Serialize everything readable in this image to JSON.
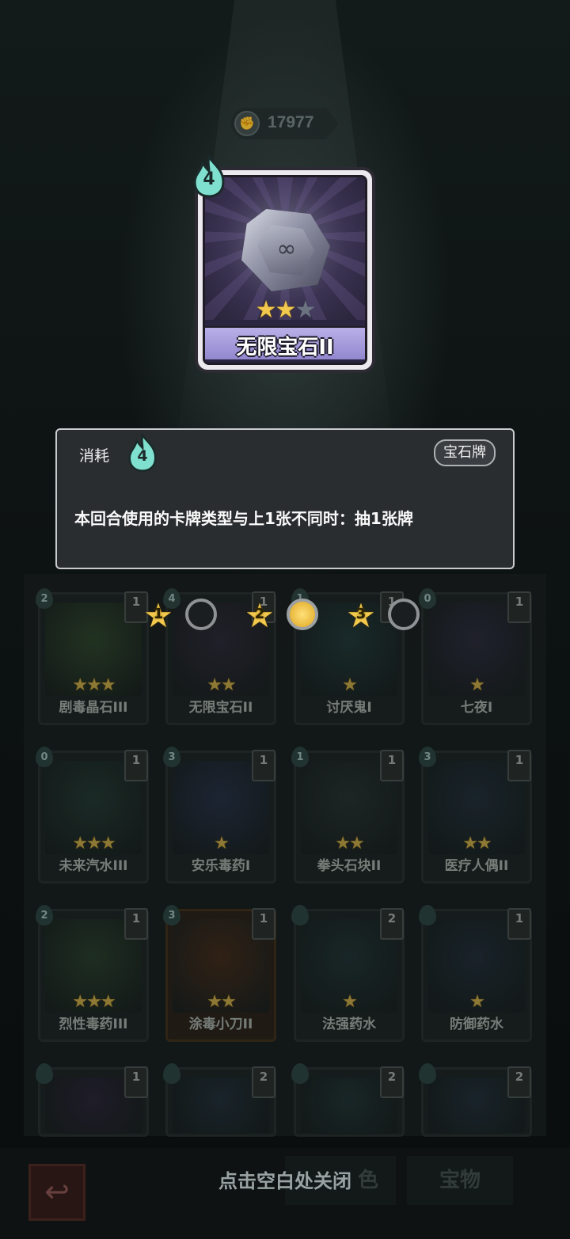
{
  "header": {
    "currency_value": "17977",
    "currency_icon": "fist-coin-icon"
  },
  "featured_card": {
    "cost": "4",
    "name": "无限宝石II",
    "stars_filled": 2,
    "stars_total": 3
  },
  "description": {
    "cost_label": "消耗",
    "cost": "4",
    "tag": "宝石牌",
    "text": "本回合使用的卡牌类型与上1张不同时：抽1张牌"
  },
  "upgrade_levels": [
    {
      "level": "1",
      "selected": false
    },
    {
      "level": "2",
      "selected": true
    },
    {
      "level": "3",
      "selected": false
    }
  ],
  "cards": [
    {
      "name": "剧毒晶石III",
      "cost": "2",
      "count": "1",
      "stars": 3,
      "art": "#2f4a2a"
    },
    {
      "name": "无限宝石II",
      "cost": "4",
      "count": "1",
      "stars": 2,
      "art": "#2b2838"
    },
    {
      "name": "讨厌鬼I",
      "cost": "1",
      "count": "1",
      "stars": 1,
      "art": "#1f3a3a"
    },
    {
      "name": "七夜I",
      "cost": "0",
      "count": "1",
      "stars": 1,
      "art": "#2a2a3e"
    },
    {
      "name": "未来汽水III",
      "cost": "0",
      "count": "1",
      "stars": 3,
      "art": "#223a32"
    },
    {
      "name": "安乐毒药I",
      "cost": "3",
      "count": "1",
      "stars": 1,
      "art": "#25304a"
    },
    {
      "name": "拳头石块II",
      "cost": "1",
      "count": "1",
      "stars": 2,
      "art": "#263030"
    },
    {
      "name": "医疗人偶II",
      "cost": "3",
      "count": "1",
      "stars": 2,
      "art": "#1f2e3a"
    },
    {
      "name": "烈性毒药III",
      "cost": "2",
      "count": "1",
      "stars": 3,
      "art": "#28402a"
    },
    {
      "name": "涂毒小刀II",
      "cost": "3",
      "count": "1",
      "stars": 2,
      "art": "#4a2a14"
    },
    {
      "name": "法强药水",
      "cost": "",
      "count": "2",
      "stars": 1,
      "art": "#1f3234"
    },
    {
      "name": "防御药水",
      "cost": "",
      "count": "1",
      "stars": 1,
      "art": "#1e2c38"
    },
    {
      "name": "",
      "cost": "",
      "count": "1",
      "stars": 0,
      "art": "#2a2238"
    },
    {
      "name": "",
      "cost": "",
      "count": "2",
      "stars": 0,
      "art": "#1f2e3a"
    },
    {
      "name": "",
      "cost": "",
      "count": "2",
      "stars": 0,
      "art": "#1f3234"
    },
    {
      "name": "",
      "cost": "",
      "count": "2",
      "stars": 0,
      "art": "#1f2e3a"
    }
  ],
  "bottom": {
    "close_hint": "点击空白处关闭",
    "tab_left": "色",
    "tab_right": "宝物"
  }
}
